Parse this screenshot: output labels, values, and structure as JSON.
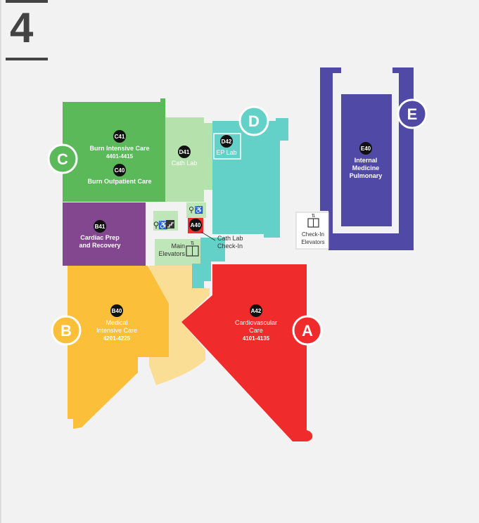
{
  "floor": {
    "number": "4"
  },
  "zones": {
    "C": {
      "letter": "C",
      "color": "#5bb95a"
    },
    "D": {
      "letter": "D",
      "color": "#63d1c7"
    },
    "E": {
      "letter": "E",
      "color": "#4f4aa6"
    },
    "B": {
      "letter": "B",
      "color": "#fbbf3a"
    },
    "A": {
      "letter": "A",
      "color": "#f02b2b"
    }
  },
  "rooms": {
    "c41": {
      "code": "C41",
      "name": "Burn Intensive Care",
      "range": "4401-4415"
    },
    "c40": {
      "code": "C40",
      "name": "Burn Outpatient Care"
    },
    "d41": {
      "code": "D41",
      "name": "Cath Lab"
    },
    "d42": {
      "code": "D42",
      "name": "EP Lab"
    },
    "e40": {
      "code": "E40",
      "name_line1": "Internal",
      "name_line2": "Medicine",
      "name_line3": "Pulmonary"
    },
    "b41": {
      "code": "B41",
      "name_line1": "Cardiac Prep",
      "name_line2": "and Recovery"
    },
    "b40": {
      "code": "B40",
      "name_line1": "Medical",
      "name_line2": "Intensive Care",
      "range": "4201-4225"
    },
    "a42": {
      "code": "A42",
      "name_line1": "Cardiovascular",
      "name_line2": "Care",
      "range": "4101-4135"
    },
    "a40": {
      "code": "A40"
    }
  },
  "labels": {
    "cath_checkin_line1": "Cath Lab",
    "cath_checkin_line2": "Check-In",
    "main_elev_line1": "Main",
    "main_elev_line2": "Elevators",
    "checkin_elev_line1": "Check-In",
    "checkin_elev_line2": "Elevators"
  },
  "icons": [
    "restroom-icon",
    "accessible-icon",
    "stairs-icon",
    "elevator-icon"
  ]
}
